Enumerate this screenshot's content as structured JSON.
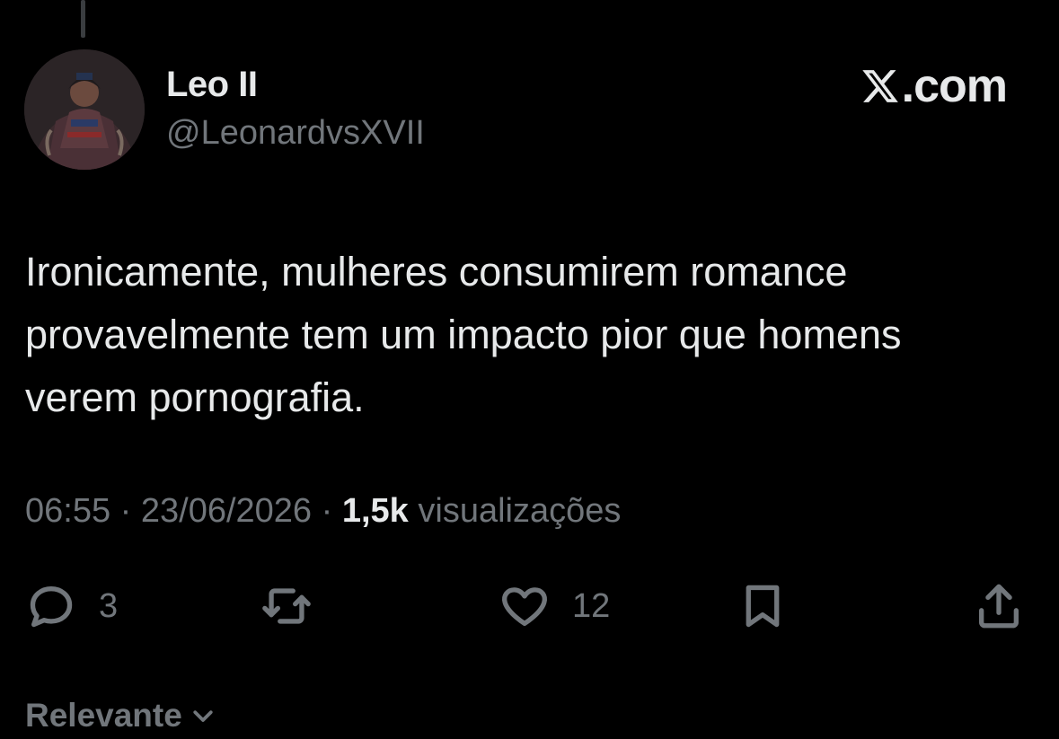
{
  "author": {
    "display_name": "Leo II",
    "handle": "@LeonardvsXVII"
  },
  "brand": {
    "text": ".com",
    "icon": "x-logo-icon"
  },
  "tweet": {
    "text": "Ironicamente, mulheres consumirem romance\nprovavelmente tem um impacto pior que homens\nverem pornografia."
  },
  "meta": {
    "time": "06:55",
    "separator": "·",
    "date": "23/06/2026",
    "views_count": "1,5k",
    "views_label": "visualizações"
  },
  "actions": {
    "reply": {
      "icon": "reply-icon",
      "count": "3"
    },
    "retweet": {
      "icon": "retweet-icon"
    },
    "like": {
      "icon": "heart-icon",
      "count": "12"
    },
    "bookmark": {
      "icon": "bookmark-icon"
    },
    "share": {
      "icon": "share-icon"
    }
  },
  "replies_sort": {
    "label": "Relevante",
    "icon": "chevron-down-icon"
  },
  "colors": {
    "background": "#000000",
    "primary_text": "#e7e9ea",
    "secondary_text": "#71767b"
  }
}
